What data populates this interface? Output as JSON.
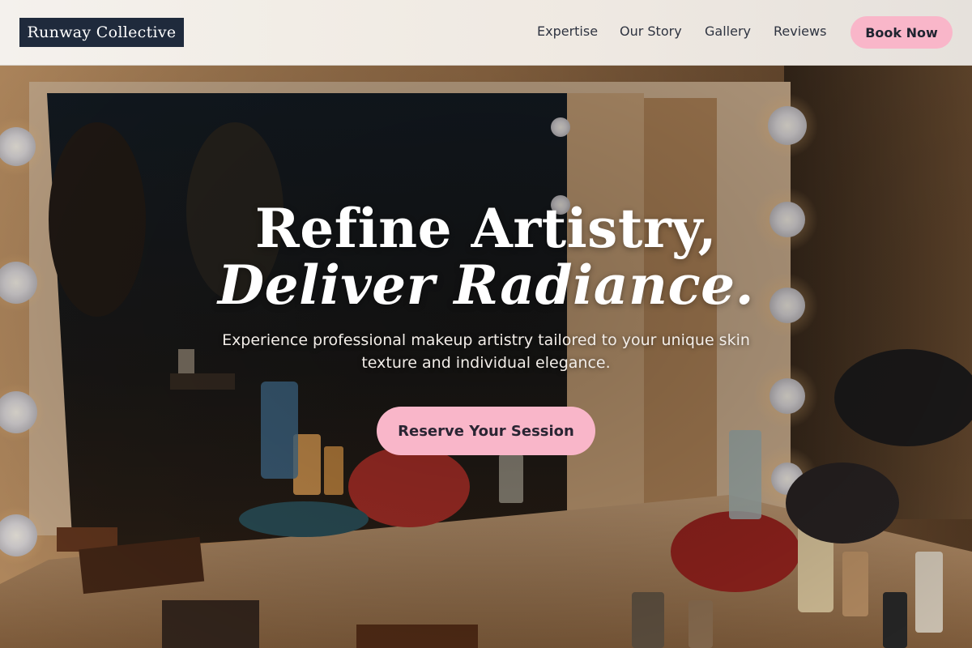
{
  "brand": {
    "name": "Runway Collective"
  },
  "nav": {
    "items": [
      {
        "label": "Expertise"
      },
      {
        "label": "Our Story"
      },
      {
        "label": "Gallery"
      },
      {
        "label": "Reviews"
      }
    ],
    "cta_label": "Book Now"
  },
  "hero": {
    "title_line1": "Refine Artistry,",
    "title_line2": "Deliver Radiance.",
    "subtitle": "Experience professional makeup artistry tailored to your unique skin texture and individual elegance.",
    "cta_label": "Reserve Your Session",
    "background": "makeup vanity mirror with bulb lights and cosmetics"
  },
  "colors": {
    "accent_pink": "#f9b6c9",
    "logo_bg": "#1f2a3c",
    "nav_text": "#2e3340"
  }
}
